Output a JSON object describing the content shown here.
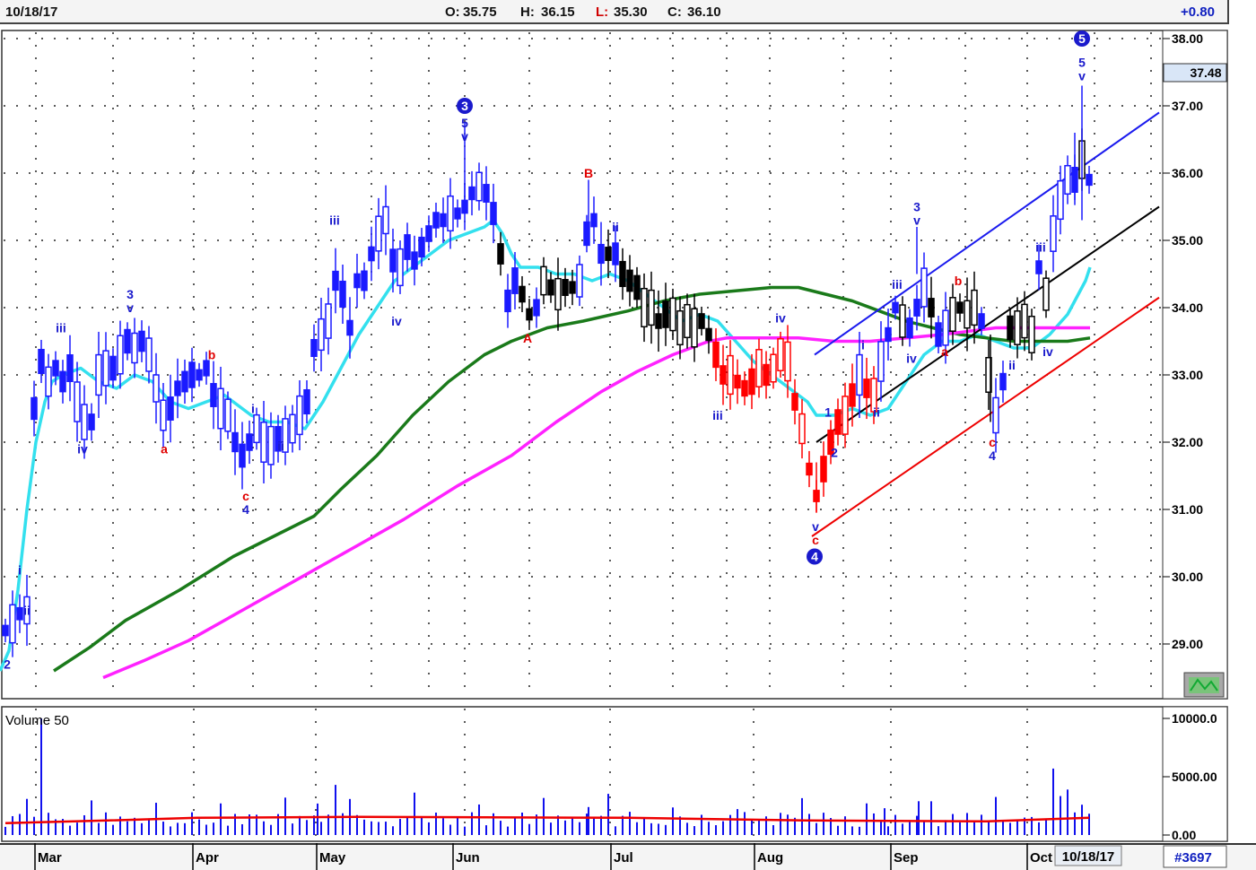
{
  "header": {
    "date": "10/18/17",
    "open_label": "O:",
    "open": "35.75",
    "high_label": "H:",
    "high": "36.15",
    "low_label": "L:",
    "low": "35.30",
    "close_label": "C:",
    "close": "36.10",
    "change": "+0.80"
  },
  "footer": {
    "date_badge": "10/18/17",
    "symbol_number": "#3697"
  },
  "colors": {
    "up_candle": "#1a1aff",
    "down_candle": "#000000",
    "red_candle": "#ff0000",
    "ma_fast": "#33e0ee",
    "ma_mid": "#1a7a1a",
    "ma_slow": "#ff22ff",
    "volume_bars": "#1010ee",
    "volume_avg": "#ee0000",
    "blue_channel": "#1a1aee",
    "black_channel": "#000000",
    "red_channel": "#ee0000"
  },
  "chart_data": [
    {
      "type": "candlestick",
      "title": "",
      "ylim": [
        28.5,
        38.1
      ],
      "yticks": [
        "38.00",
        "37.00",
        "36.00",
        "35.00",
        "34.00",
        "33.00",
        "32.00",
        "31.00",
        "30.00",
        "29.00"
      ],
      "last_price_label": "37.48",
      "x_months": [
        "Mar",
        "Apr",
        "May",
        "Jun",
        "Jul",
        "Aug",
        "Sep",
        "Oct"
      ],
      "grid": true,
      "series": [
        {
          "color_key": "ma_fast",
          "values": [
            [
              0,
              28.6
            ],
            [
              10,
              28.9
            ],
            [
              20,
              29.8
            ],
            [
              30,
              31.0
            ],
            [
              40,
              32.0
            ],
            [
              50,
              32.6
            ],
            [
              58,
              32.9
            ],
            [
              70,
              33.0
            ],
            [
              90,
              33.1
            ],
            [
              110,
              32.9
            ],
            [
              130,
              32.8
            ],
            [
              150,
              33.0
            ],
            [
              170,
              32.9
            ],
            [
              190,
              32.6
            ],
            [
              210,
              32.5
            ],
            [
              230,
              32.6
            ],
            [
              250,
              32.7
            ],
            [
              260,
              32.6
            ],
            [
              280,
              32.4
            ],
            [
              300,
              32.3
            ],
            [
              320,
              32.3
            ],
            [
              340,
              32.2
            ],
            [
              360,
              32.6
            ],
            [
              380,
              33.1
            ],
            [
              400,
              33.6
            ],
            [
              420,
              34.0
            ],
            [
              440,
              34.4
            ],
            [
              460,
              34.6
            ],
            [
              480,
              34.8
            ],
            [
              500,
              35.0
            ],
            [
              520,
              35.1
            ],
            [
              540,
              35.2
            ],
            [
              550,
              35.3
            ],
            [
              560,
              35.1
            ],
            [
              570,
              34.8
            ],
            [
              580,
              34.6
            ],
            [
              600,
              34.6
            ],
            [
              620,
              34.5
            ],
            [
              640,
              34.5
            ],
            [
              660,
              34.4
            ],
            [
              680,
              34.5
            ],
            [
              700,
              34.4
            ],
            [
              720,
              34.2
            ],
            [
              740,
              34.0
            ],
            [
              760,
              33.8
            ],
            [
              780,
              33.9
            ],
            [
              800,
              33.8
            ],
            [
              820,
              33.5
            ],
            [
              840,
              33.2
            ],
            [
              860,
              33.0
            ],
            [
              880,
              32.8
            ],
            [
              900,
              32.6
            ],
            [
              910,
              32.4
            ],
            [
              930,
              32.4
            ],
            [
              950,
              32.5
            ],
            [
              970,
              32.4
            ],
            [
              990,
              32.5
            ],
            [
              1010,
              32.9
            ],
            [
              1030,
              33.3
            ],
            [
              1050,
              33.5
            ],
            [
              1070,
              33.5
            ],
            [
              1090,
              33.6
            ],
            [
              1110,
              33.5
            ],
            [
              1130,
              33.4
            ],
            [
              1150,
              33.4
            ],
            [
              1170,
              33.6
            ],
            [
              1190,
              33.9
            ],
            [
              1210,
              34.4
            ],
            [
              1215,
              34.6
            ]
          ]
        },
        {
          "color_key": "ma_mid",
          "values": [
            [
              60,
              28.6
            ],
            [
              100,
              28.95
            ],
            [
              140,
              29.35
            ],
            [
              200,
              29.8
            ],
            [
              260,
              30.3
            ],
            [
              320,
              30.7
            ],
            [
              350,
              30.9
            ],
            [
              380,
              31.3
            ],
            [
              420,
              31.8
            ],
            [
              460,
              32.4
            ],
            [
              500,
              32.9
            ],
            [
              540,
              33.3
            ],
            [
              570,
              33.5
            ],
            [
              610,
              33.7
            ],
            [
              650,
              33.8
            ],
            [
              700,
              33.95
            ],
            [
              740,
              34.1
            ],
            [
              780,
              34.2
            ],
            [
              820,
              34.25
            ],
            [
              860,
              34.3
            ],
            [
              890,
              34.3
            ],
            [
              920,
              34.2
            ],
            [
              950,
              34.1
            ],
            [
              980,
              33.95
            ],
            [
              1010,
              33.8
            ],
            [
              1040,
              33.7
            ],
            [
              1070,
              33.6
            ],
            [
              1100,
              33.55
            ],
            [
              1130,
              33.5
            ],
            [
              1160,
              33.5
            ],
            [
              1190,
              33.5
            ],
            [
              1215,
              33.55
            ]
          ]
        },
        {
          "color_key": "ma_slow",
          "values": [
            [
              115,
              28.5
            ],
            [
              160,
              28.75
            ],
            [
              210,
              29.05
            ],
            [
              270,
              29.5
            ],
            [
              330,
              29.95
            ],
            [
              390,
              30.4
            ],
            [
              450,
              30.85
            ],
            [
              510,
              31.35
            ],
            [
              570,
              31.8
            ],
            [
              620,
              32.3
            ],
            [
              670,
              32.75
            ],
            [
              710,
              33.05
            ],
            [
              750,
              33.3
            ],
            [
              790,
              33.5
            ],
            [
              810,
              33.55
            ],
            [
              850,
              33.55
            ],
            [
              890,
              33.55
            ],
            [
              930,
              33.5
            ],
            [
              970,
              33.5
            ],
            [
              1010,
              33.55
            ],
            [
              1050,
              33.6
            ],
            [
              1080,
              33.65
            ],
            [
              1110,
              33.7
            ],
            [
              1140,
              33.7
            ],
            [
              1180,
              33.7
            ],
            [
              1215,
              33.7
            ]
          ]
        }
      ],
      "trendlines": [
        {
          "color_key": "blue_channel",
          "values": [
            [
              908,
              33.3
            ],
            [
              1292,
              36.9
            ]
          ]
        },
        {
          "color_key": "black_channel",
          "values": [
            [
              910,
              32.0
            ],
            [
              1292,
              35.5
            ]
          ]
        },
        {
          "color_key": "red_channel",
          "values": [
            [
              905,
              30.6
            ],
            [
              1292,
              34.15
            ]
          ]
        }
      ],
      "annotations": [
        {
          "text": "2",
          "x": 8,
          "y": 28.7,
          "color": "blue"
        },
        {
          "text": "i",
          "x": 22,
          "y": 30.1,
          "color": "blue"
        },
        {
          "text": "ii",
          "x": 30,
          "y": 29.5,
          "color": "blue"
        },
        {
          "text": "iii",
          "x": 68,
          "y": 33.7,
          "color": "blue"
        },
        {
          "text": "iv",
          "x": 92,
          "y": 31.9,
          "color": "blue"
        },
        {
          "text": "3",
          "x": 145,
          "y": 34.2,
          "color": "blue"
        },
        {
          "text": "v",
          "x": 145,
          "y": 34.0,
          "color": "blue"
        },
        {
          "text": "a",
          "x": 183,
          "y": 31.9,
          "color": "red"
        },
        {
          "text": "b",
          "x": 236,
          "y": 33.3,
          "color": "red"
        },
        {
          "text": "i",
          "x": 282,
          "y": 32.5,
          "color": "blue"
        },
        {
          "text": "c",
          "x": 274,
          "y": 31.2,
          "color": "red"
        },
        {
          "text": "4",
          "x": 274,
          "y": 31.0,
          "color": "blue"
        },
        {
          "text": "ii",
          "x": 313,
          "y": 31.95,
          "color": "blue"
        },
        {
          "text": "iii",
          "x": 373,
          "y": 35.3,
          "color": "blue"
        },
        {
          "text": "iv",
          "x": 442,
          "y": 33.8,
          "color": "blue"
        },
        {
          "text": "3",
          "x": 518,
          "y": 37.0,
          "circled": true,
          "color": "blue"
        },
        {
          "text": "5",
          "x": 518,
          "y": 36.75,
          "color": "blue"
        },
        {
          "text": "v",
          "x": 518,
          "y": 36.55,
          "color": "blue"
        },
        {
          "text": "B",
          "x": 656,
          "y": 36.0,
          "color": "red"
        },
        {
          "text": "ii",
          "x": 686,
          "y": 35.2,
          "color": "blue"
        },
        {
          "text": "A",
          "x": 588,
          "y": 33.55,
          "color": "red"
        },
        {
          "text": "iii",
          "x": 800,
          "y": 32.4,
          "color": "blue"
        },
        {
          "text": "iv",
          "x": 870,
          "y": 33.85,
          "color": "blue"
        },
        {
          "text": "v",
          "x": 909,
          "y": 30.75,
          "color": "blue"
        },
        {
          "text": "c",
          "x": 909,
          "y": 30.55,
          "color": "red"
        },
        {
          "text": "4",
          "x": 908,
          "y": 30.3,
          "circled": true,
          "color": "blue"
        },
        {
          "text": "1",
          "x": 923,
          "y": 32.45,
          "color": "blue"
        },
        {
          "text": "2",
          "x": 930,
          "y": 31.85,
          "color": "blue"
        },
        {
          "text": "i",
          "x": 962,
          "y": 33.45,
          "color": "blue"
        },
        {
          "text": "ii",
          "x": 977,
          "y": 32.45,
          "color": "blue"
        },
        {
          "text": "iii",
          "x": 1000,
          "y": 34.35,
          "color": "blue"
        },
        {
          "text": "3",
          "x": 1022,
          "y": 35.5,
          "color": "blue"
        },
        {
          "text": "v",
          "x": 1022,
          "y": 35.3,
          "color": "blue"
        },
        {
          "text": "iv",
          "x": 1016,
          "y": 33.25,
          "color": "blue"
        },
        {
          "text": "a",
          "x": 1053,
          "y": 33.35,
          "color": "red"
        },
        {
          "text": "b",
          "x": 1068,
          "y": 34.4,
          "color": "red"
        },
        {
          "text": "ii",
          "x": 1128,
          "y": 33.15,
          "color": "blue"
        },
        {
          "text": "c",
          "x": 1106,
          "y": 32.0,
          "color": "red"
        },
        {
          "text": "4",
          "x": 1106,
          "y": 31.8,
          "color": "blue"
        },
        {
          "text": "iii",
          "x": 1160,
          "y": 34.9,
          "color": "blue"
        },
        {
          "text": "iv",
          "x": 1168,
          "y": 33.35,
          "color": "blue"
        },
        {
          "text": "5",
          "x": 1206,
          "y": 38.0,
          "circled": true,
          "color": "blue"
        },
        {
          "text": "5",
          "x": 1206,
          "y": 37.65,
          "color": "blue"
        },
        {
          "text": "v",
          "x": 1206,
          "y": 37.45,
          "color": "blue"
        }
      ]
    },
    {
      "type": "bar",
      "title": "Volume 50",
      "ylim": [
        0,
        10000
      ],
      "yticks": [
        "10000.0",
        "5000.00",
        "0.00"
      ],
      "volume_average_level": 1400
    }
  ]
}
